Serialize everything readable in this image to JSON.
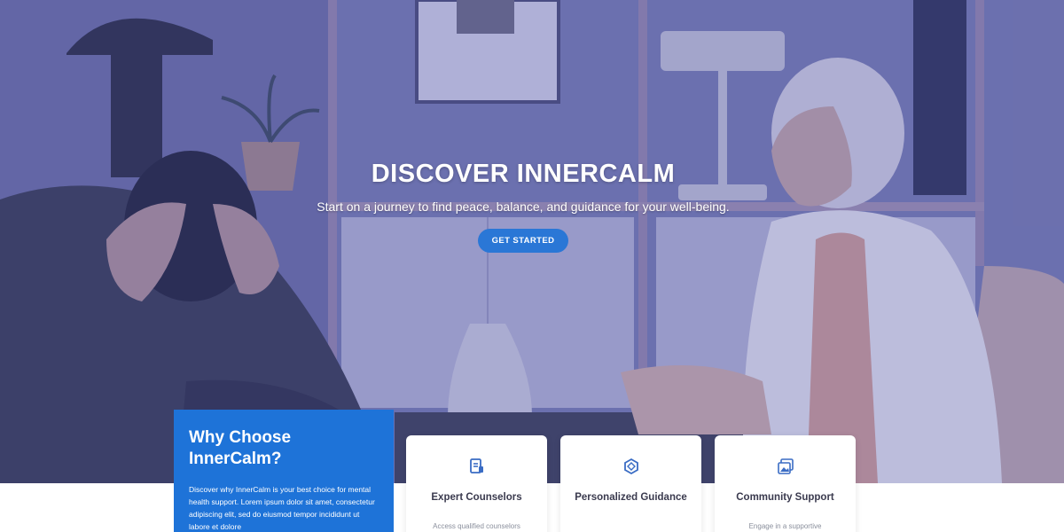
{
  "hero": {
    "title": "DISCOVER INNERCALM",
    "subtitle": "Start on a journey to find peace, balance, and guidance for your well-being.",
    "cta_label": "GET STARTED"
  },
  "why": {
    "title": "Why Choose InnerCalm?",
    "text": "Discover why InnerCalm is your best choice for mental health support. Lorem ipsum dolor sit amet, consectetur adipiscing elit, sed do eiusmod tempor incididunt ut labore et dolore"
  },
  "features": [
    {
      "title": "Expert Counselors",
      "description": "Access qualified counselors",
      "icon": "document-icon"
    },
    {
      "title": "Personalized Guidance",
      "description": "",
      "icon": "hexagon-icon"
    },
    {
      "title": "Community Support",
      "description": "Engage in a supportive",
      "icon": "gallery-icon"
    }
  ],
  "colors": {
    "accent": "#1e73d8",
    "button": "#2a77d6",
    "hero_tint": "#6f72a9",
    "icon": "#3a6cc4"
  }
}
